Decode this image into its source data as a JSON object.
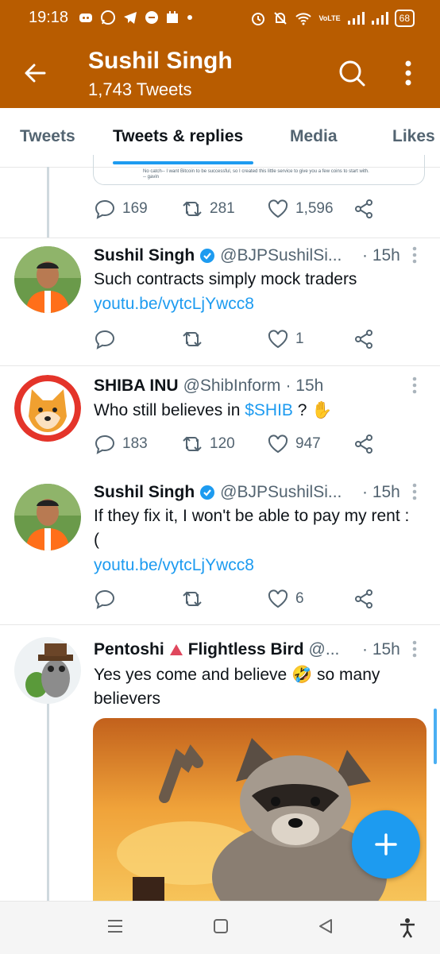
{
  "status_bar": {
    "time": "19:18",
    "battery": "68",
    "volte": "VoLTE"
  },
  "header": {
    "title": "Sushil Singh",
    "subtitle": "1,743 Tweets"
  },
  "tabs": [
    {
      "label": "Tweets"
    },
    {
      "label": "Tweets & replies"
    },
    {
      "label": "Media"
    },
    {
      "label": "Likes"
    }
  ],
  "preview_card": {
    "text": "No catch-- I want Bitcoin to be successful, so I created this little service to give you a few coins to start with.\n-- gavin"
  },
  "tweets": [
    {
      "replies": "169",
      "retweets": "281",
      "likes": "1,596"
    },
    {
      "name": "Sushil Singh",
      "handle": "@BJPSushilSi...",
      "time": "· 15h",
      "text": "Such contracts simply mock traders",
      "link": "youtu.be/vytcLjYwcc8",
      "replies": "",
      "retweets": "",
      "likes": "1"
    },
    {
      "name": "SHIBA INU",
      "handle": "@ShibInform",
      "time": "· 15h",
      "text": "Who still believes in ",
      "cashtag": "$SHIB",
      "text_after": " ? ✋",
      "replies": "183",
      "retweets": "120",
      "likes": "947"
    },
    {
      "name": "Sushil Singh",
      "handle": "@BJPSushilSi...",
      "time": "· 15h",
      "text": "If they fix it, I won't be able to pay my rent :(",
      "link": "youtu.be/vytcLjYwcc8",
      "replies": "",
      "retweets": "",
      "likes": "6"
    },
    {
      "name": "Pentoshi",
      "name_suffix": "Flightless Bird",
      "handle": "@...",
      "time": "· 15h",
      "text": "Yes yes come and believe 🤣 so many believers"
    }
  ],
  "colors": {
    "brand": "#b85c00",
    "accent": "#1d9bf0"
  }
}
